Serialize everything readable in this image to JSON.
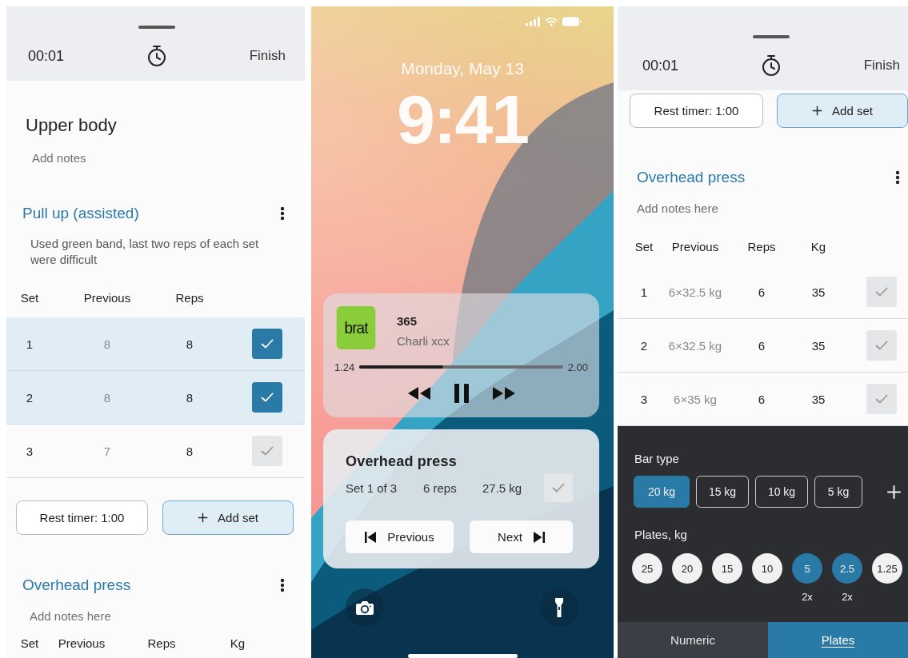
{
  "workout_screen": {
    "header": {
      "elapsed": "00:01",
      "finish": "Finish"
    },
    "title": "Upper body",
    "notes_placeholder": "Add notes",
    "exercises": [
      {
        "name": "Pull up (assisted)",
        "note": "Used green band, last two reps of each set were difficult",
        "columns": [
          "Set",
          "Previous",
          "Reps"
        ],
        "sets": [
          {
            "cells": [
              "1",
              "8",
              "8"
            ],
            "done": true
          },
          {
            "cells": [
              "2",
              "8",
              "8"
            ],
            "done": true
          },
          {
            "cells": [
              "3",
              "7",
              "8"
            ],
            "done": false
          }
        ],
        "rest_timer": "Rest timer: 1:00",
        "add_set": "Add set"
      },
      {
        "name": "Overhead press",
        "notes_placeholder": "Add notes here",
        "columns": [
          "Set",
          "Previous",
          "Reps",
          "Kg"
        ]
      }
    ]
  },
  "lock_screen": {
    "date": "Monday, May 13",
    "time": "9:41",
    "now_playing": {
      "album_art": "brat",
      "title": "365",
      "artist": "Charli xcx",
      "elapsed": "1.24",
      "total": "2.00",
      "level": 0.41
    },
    "exercise_widget": {
      "title": "Overhead press",
      "set": "Set 1 of 3",
      "reps": "6 reps",
      "weight": "27.5 kg",
      "done": false,
      "previous": "Previous",
      "next": "Next"
    }
  },
  "plates_screen": {
    "header": {
      "elapsed": "00:01",
      "finish": "Finish"
    },
    "rest_timer": "Rest timer: 1:00",
    "add_set": "Add set",
    "exercise": {
      "name": "Overhead press",
      "notes_placeholder": "Add notes here",
      "columns": [
        "Set",
        "Previous",
        "Reps",
        "Kg"
      ],
      "sets": [
        {
          "cells": [
            "1",
            "6×32.5 kg",
            "6",
            "35"
          ],
          "done": false
        },
        {
          "cells": [
            "2",
            "6×32.5 kg",
            "6",
            "35"
          ],
          "done": false
        },
        {
          "cells": [
            "3",
            "6×35 kg",
            "6",
            "35"
          ],
          "done": false
        }
      ]
    },
    "plate_picker": {
      "bar_type_label": "Bar type",
      "bars": [
        {
          "label": "20 kg",
          "selected": true
        },
        {
          "label": "15 kg",
          "selected": false
        },
        {
          "label": "10 kg",
          "selected": false
        },
        {
          "label": "5 kg",
          "selected": false
        }
      ],
      "plates_label": "Plates, kg",
      "plates": [
        {
          "label": "25",
          "selected": false
        },
        {
          "label": "20",
          "selected": false
        },
        {
          "label": "15",
          "selected": false
        },
        {
          "label": "10",
          "selected": false
        },
        {
          "label": "5",
          "selected": true,
          "count": "2x"
        },
        {
          "label": "2.5",
          "selected": true,
          "count": "2x"
        },
        {
          "label": "1.25",
          "selected": false
        }
      ],
      "tabs": [
        {
          "label": "Numeric",
          "selected": false
        },
        {
          "label": "Plates",
          "selected": true
        }
      ]
    }
  }
}
